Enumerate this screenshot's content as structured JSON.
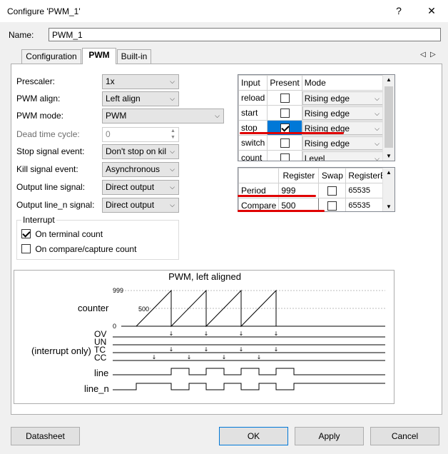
{
  "window": {
    "title": "Configure 'PWM_1'",
    "help_glyph": "?",
    "close_glyph": "✕"
  },
  "name_row": {
    "label": "Name:",
    "value": "PWM_1"
  },
  "tabs": [
    {
      "label": "Configuration",
      "active": false
    },
    {
      "label": "PWM",
      "active": true
    },
    {
      "label": "Built-in",
      "active": false
    }
  ],
  "tab_nav": {
    "left": "◁",
    "right": "▷"
  },
  "params": [
    {
      "label": "Prescaler:",
      "value": "1x"
    },
    {
      "label": "PWM align:",
      "value": "Left align"
    },
    {
      "label": "PWM mode:",
      "value": "PWM"
    },
    {
      "label": "Dead time cycle:",
      "value": "0"
    },
    {
      "label": "Stop signal event:",
      "value": "Don't stop on kil"
    },
    {
      "label": "Kill signal event:",
      "value": "Asynchronous"
    },
    {
      "label": "Output line signal:",
      "value": "Direct output"
    },
    {
      "label": "Output line_n signal:",
      "value": "Direct output"
    }
  ],
  "interrupt": {
    "title": "Interrupt",
    "items": [
      {
        "label": "On terminal count",
        "checked": true
      },
      {
        "label": "On compare/capture count",
        "checked": false
      }
    ]
  },
  "inputs_table": {
    "headers": [
      "Input",
      "Present",
      "Mode"
    ],
    "rows": [
      {
        "input": "reload",
        "present": false,
        "mode": "Rising edge"
      },
      {
        "input": "start",
        "present": false,
        "mode": "Rising edge"
      },
      {
        "input": "stop",
        "present": true,
        "mode": "Rising edge"
      },
      {
        "input": "switch",
        "present": false,
        "mode": "Rising edge"
      },
      {
        "input": "count",
        "present": false,
        "mode": "Level"
      }
    ]
  },
  "registers_table": {
    "headers": [
      "",
      "Register",
      "Swap",
      "RegisterB"
    ],
    "rows": [
      {
        "name": "Period",
        "register": "999",
        "swap": false,
        "register_b": "65535"
      },
      {
        "name": "Compare",
        "register": "500",
        "swap": false,
        "register_b": "65535"
      }
    ]
  },
  "diagram": {
    "title": "PWM, left aligned",
    "counter_label": "counter",
    "ticks": [
      "999",
      "500",
      "0"
    ],
    "signals": [
      "OV",
      "UN",
      "TC",
      "CC"
    ],
    "interrupt_label": "(interrupt only)",
    "line_label": "line",
    "line_n_label": "line_n"
  },
  "buttons": {
    "datasheet": "Datasheet",
    "ok": "OK",
    "apply": "Apply",
    "cancel": "Cancel"
  },
  "colors": {
    "selected_cell": "#0078d7",
    "annotation": "#e00000",
    "accent": "#0078d7"
  }
}
